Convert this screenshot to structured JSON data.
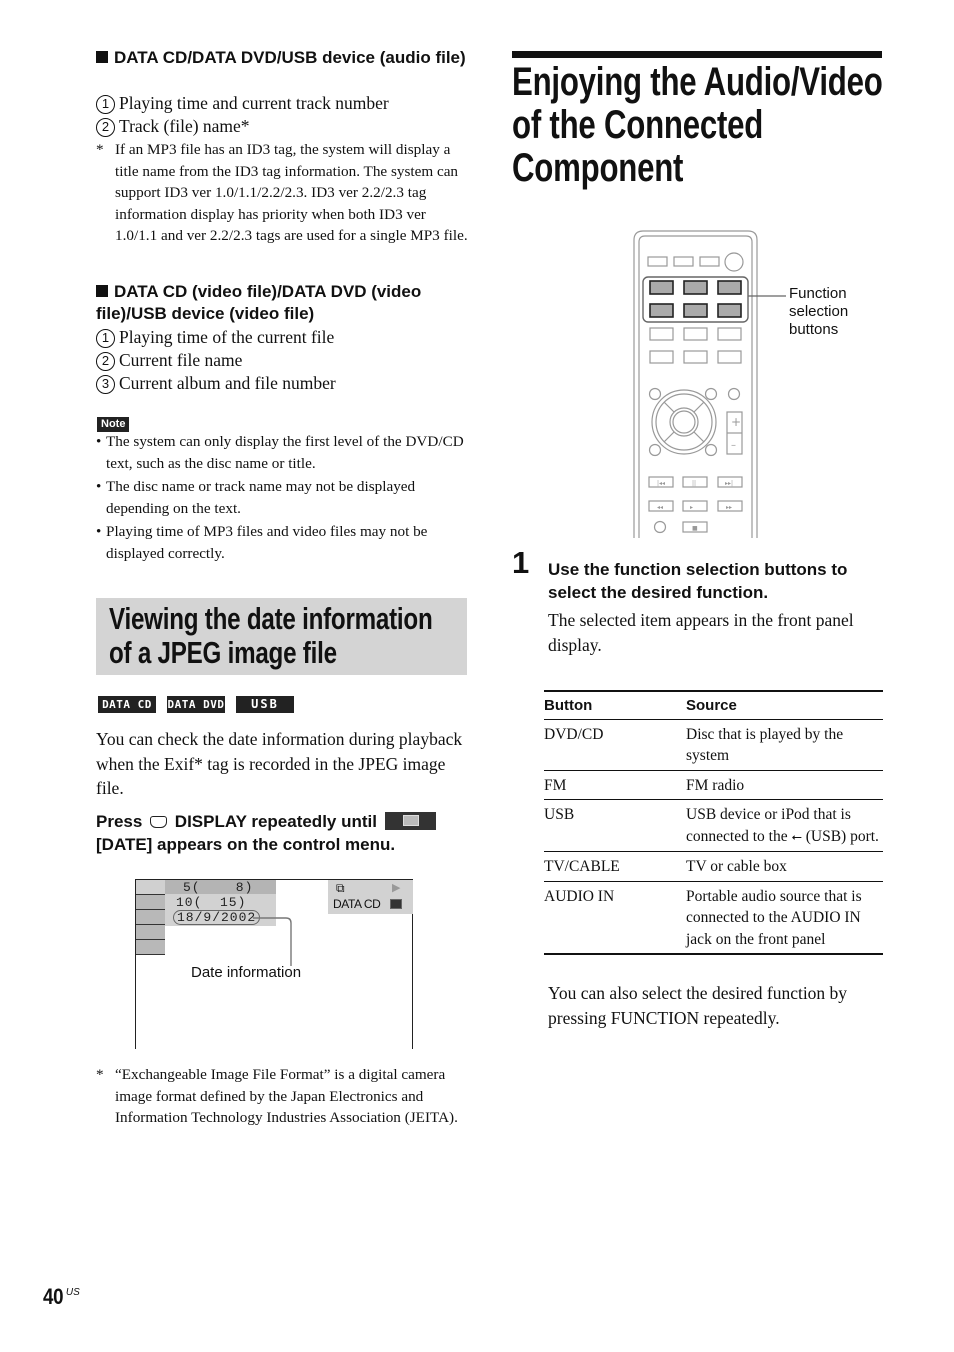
{
  "left_column": {
    "section_audio": {
      "heading": "DATA CD/DATA DVD/USB device (audio file)",
      "items": [
        {
          "num": "1",
          "text": "Playing time and current track number"
        },
        {
          "num": "2",
          "text": "Track (file) name*"
        }
      ],
      "footnote_mark": "*",
      "footnote": "If an MP3 file has an ID3 tag, the system will display a title name from the ID3 tag information. The system can support ID3 ver 1.0/1.1/2.2/2.3. ID3 ver 2.2/2.3 tag information display has priority when both ID3 ver 1.0/1.1 and ver 2.2/2.3 tags are used for a single MP3 file."
    },
    "section_video": {
      "heading": "DATA CD (video file)/DATA DVD (video file)/USB device (video file)",
      "items": [
        {
          "num": "1",
          "text": "Playing time of the current file"
        },
        {
          "num": "2",
          "text": "Current file name"
        },
        {
          "num": "3",
          "text": "Current album and file number"
        }
      ]
    },
    "note": {
      "label": "Note",
      "bullets": [
        "The system can only display the first level of the DVD/CD text, such as the disc name or title.",
        "The disc name or track name may not be displayed depending on the text.",
        "Playing time of MP3 files and video files may not be displayed correctly."
      ]
    },
    "jpeg_section": {
      "title_line1": "Viewing the date information",
      "title_line2": "of a JPEG image file",
      "badges": [
        "DATA CD",
        "DATA DVD",
        "USB"
      ],
      "intro": "You can check the date information during playback when the Exif* tag is recorded in the JPEG image file.",
      "instruction_part1": "Press",
      "instruction_part2": "DISPLAY repeatedly until",
      "instruction_part3": "[DATE] appears on the control menu.",
      "osd": {
        "line1": "5(    8)",
        "line2": "10(  15)",
        "line3": "18/9/2002",
        "media_label": "DATA CD",
        "callout": "Date information"
      },
      "footnote_mark": "*",
      "footnote": "“Exchangeable Image File Format” is a digital camera image format defined by the Japan Electronics and Information Technology Industries Association (JEITA)."
    }
  },
  "right_column": {
    "title_line1": "Enjoying the Audio/Video",
    "title_line2": "of the Connected",
    "title_line3": "Component",
    "remote_callout": "Function selection buttons",
    "step": {
      "number": "1",
      "heading": "Use the function selection buttons to select the desired function.",
      "body": "The selected item appears in the front panel display."
    },
    "table": {
      "headers": [
        "Button",
        "Source"
      ],
      "rows": [
        {
          "button": "DVD/CD",
          "source": "Disc that is played by the system"
        },
        {
          "button": "FM",
          "source": "FM radio"
        },
        {
          "button": "USB",
          "source_pre": "USB device or iPod that is connected to the",
          "source_post": "(USB) port."
        },
        {
          "button": "TV/CABLE",
          "source": "TV or cable box"
        },
        {
          "button": "AUDIO IN",
          "source": "Portable audio source that is connected to the AUDIO IN jack on the front panel"
        }
      ]
    },
    "closing": "You can also select the desired function by pressing FUNCTION repeatedly."
  },
  "footer": {
    "page_number": "40",
    "region": "US"
  }
}
